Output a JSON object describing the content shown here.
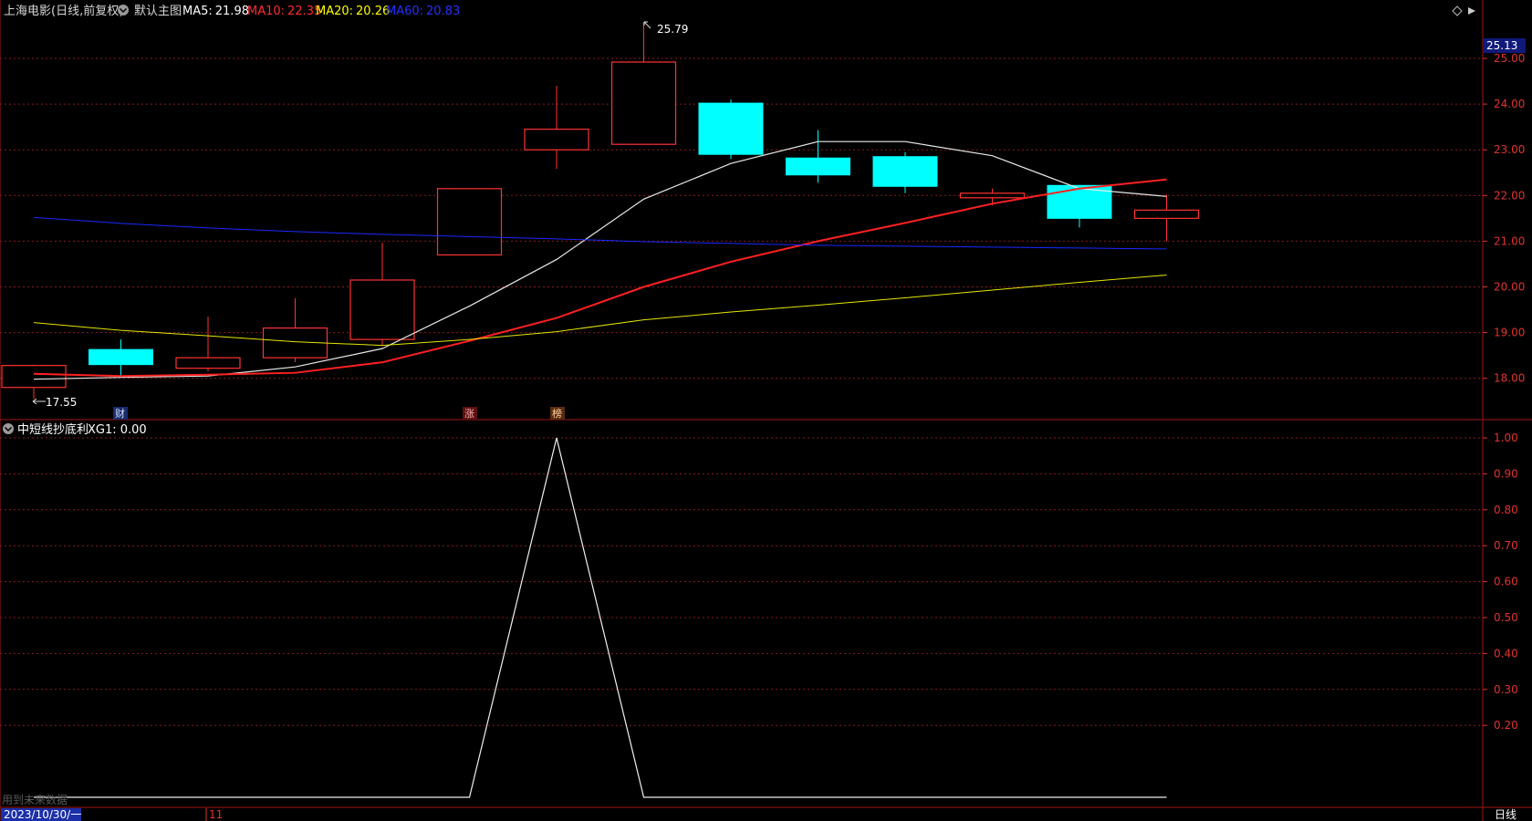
{
  "header": {
    "title": "上海电影(日线,前复权)",
    "main_chart_label": "默认主图",
    "ma_items": [
      {
        "label": "MA5:",
        "value": "21.98",
        "color": "#ffffff"
      },
      {
        "label": "MA10:",
        "value": "22.35",
        "color": "#ff2d2d"
      },
      {
        "label": "MA20:",
        "value": "20.26",
        "color": "#ffff00"
      },
      {
        "label": "MA60:",
        "value": "20.83",
        "color": "#2432ff"
      }
    ]
  },
  "sub_header": {
    "indicator_name": "中短线抄底利",
    "indicator_value": "XG1: 0.00"
  },
  "price_axis": {
    "labels": [
      "25.00",
      "24.00",
      "23.00",
      "22.00",
      "21.00",
      "20.00",
      "19.00",
      "18.00"
    ],
    "current_price": "25.13"
  },
  "indicator_axis": {
    "labels": [
      "1.00",
      "0.90",
      "0.80",
      "0.70",
      "0.60",
      "0.50",
      "0.40",
      "0.30",
      "0.20"
    ]
  },
  "annotations": {
    "high_label": "25.79",
    "low_label": "17.55",
    "markers": [
      "财",
      "涨",
      "榜"
    ]
  },
  "footer": {
    "date": "2023/10/30/一",
    "month": "11",
    "period": "日线",
    "future_data_note": "用到未来数据"
  },
  "colors": {
    "up": "#ff3232",
    "down": "#00ffff",
    "grid": "#8a1a1a",
    "axis_text": "#e0332d",
    "background": "#000000"
  },
  "chart_data": [
    {
      "type": "candlestick",
      "title": "上海电影(日线,前复权)",
      "ylim": [
        17.3,
        26.1
      ],
      "candles": [
        {
          "open": 17.8,
          "close": 18.28,
          "high": 18.3,
          "low": 17.55
        },
        {
          "open": 18.63,
          "close": 18.3,
          "high": 18.85,
          "low": 18.05
        },
        {
          "open": 18.22,
          "close": 18.45,
          "high": 19.35,
          "low": 18.15
        },
        {
          "open": 18.45,
          "close": 19.1,
          "high": 19.75,
          "low": 18.35
        },
        {
          "open": 18.85,
          "close": 20.15,
          "high": 20.97,
          "low": 18.7
        },
        {
          "open": 20.7,
          "close": 22.15,
          "high": 22.15,
          "low": 20.7
        },
        {
          "open": 23.0,
          "close": 23.45,
          "high": 24.4,
          "low": 22.58
        },
        {
          "open": 23.12,
          "close": 24.92,
          "high": 25.79,
          "low": 23.12
        },
        {
          "open": 24.02,
          "close": 22.9,
          "high": 24.1,
          "low": 22.8
        },
        {
          "open": 22.82,
          "close": 22.45,
          "high": 23.43,
          "low": 22.28
        },
        {
          "open": 22.85,
          "close": 22.2,
          "high": 22.95,
          "low": 22.05
        },
        {
          "open": 21.95,
          "close": 22.05,
          "high": 22.15,
          "low": 21.78
        },
        {
          "open": 22.22,
          "close": 21.5,
          "high": 22.22,
          "low": 21.3
        },
        {
          "open": 21.5,
          "close": 21.68,
          "high": 22.02,
          "low": 21.0
        }
      ],
      "series": [
        {
          "name": "MA5",
          "values": [
            17.98,
            18.02,
            18.05,
            18.25,
            18.65,
            19.58,
            20.6,
            21.92,
            22.7,
            23.18,
            23.18,
            22.87,
            22.15,
            21.98
          ]
        },
        {
          "name": "MA10",
          "values": [
            18.1,
            18.05,
            18.08,
            18.12,
            18.35,
            18.82,
            19.32,
            20.0,
            20.55,
            21.0,
            21.4,
            21.82,
            22.15,
            22.35
          ]
        },
        {
          "name": "MA20",
          "values": [
            19.22,
            19.05,
            18.93,
            18.8,
            18.72,
            18.85,
            19.02,
            19.28,
            19.45,
            19.6,
            19.76,
            19.93,
            20.1,
            20.26
          ]
        },
        {
          "name": "MA60",
          "values": [
            21.52,
            21.39,
            21.29,
            21.21,
            21.15,
            21.1,
            21.05,
            20.99,
            20.95,
            20.91,
            20.89,
            20.87,
            20.85,
            20.83
          ]
        }
      ]
    },
    {
      "type": "line",
      "title": "中短线抄底利",
      "ylim": [
        0,
        1.0
      ],
      "series": [
        {
          "name": "XG1",
          "values": [
            0,
            0,
            0,
            0,
            0,
            0,
            1,
            0,
            0,
            0,
            0,
            0,
            0,
            0
          ]
        }
      ]
    }
  ]
}
